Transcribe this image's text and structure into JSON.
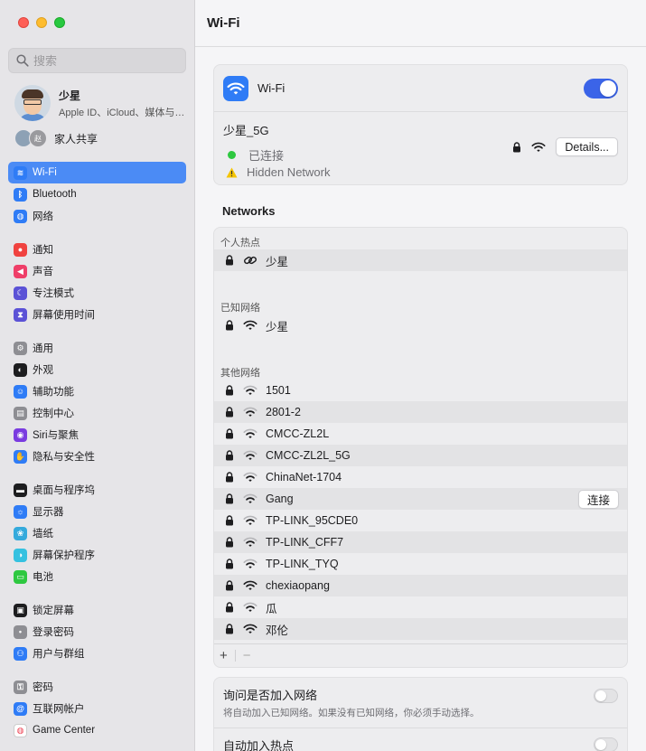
{
  "window": {
    "title": "Wi-Fi"
  },
  "search": {
    "placeholder": "搜索"
  },
  "profile": {
    "name": "少星",
    "subtitle": "Apple ID、iCloud、媒体与 App Store"
  },
  "family": {
    "label": "家人共享",
    "badge": "赵"
  },
  "sidebar": {
    "groups": [
      [
        {
          "label": "Wi-Fi",
          "icon": "wifi-icon",
          "color": "#2f7cf6",
          "active": true
        },
        {
          "label": "Bluetooth",
          "icon": "bluetooth-icon",
          "color": "#2f7cf6"
        },
        {
          "label": "网络",
          "icon": "globe-icon",
          "color": "#2f7cf6"
        }
      ],
      [
        {
          "label": "通知",
          "icon": "bell-icon",
          "color": "#f0423f"
        },
        {
          "label": "声音",
          "icon": "speaker-icon",
          "color": "#ef3e68"
        },
        {
          "label": "专注模式",
          "icon": "moon-icon",
          "color": "#5b52d6"
        },
        {
          "label": "屏幕使用时间",
          "icon": "hourglass-icon",
          "color": "#5b52d6"
        }
      ],
      [
        {
          "label": "通用",
          "icon": "gear-icon",
          "color": "#8e8e93"
        },
        {
          "label": "外观",
          "icon": "appearance-icon",
          "color": "#1d1d1f"
        },
        {
          "label": "辅助功能",
          "icon": "accessibility-icon",
          "color": "#2f7cf6"
        },
        {
          "label": "控制中心",
          "icon": "control-center-icon",
          "color": "#8e8e93"
        },
        {
          "label": "Siri与聚焦",
          "icon": "siri-icon",
          "color": "#7a3be0"
        },
        {
          "label": "隐私与安全性",
          "icon": "hand-icon",
          "color": "#2f7cf6"
        }
      ],
      [
        {
          "label": "桌面与程序坞",
          "icon": "dock-icon",
          "color": "#1d1d1f"
        },
        {
          "label": "显示器",
          "icon": "display-icon",
          "color": "#2f7cf6"
        },
        {
          "label": "墙纸",
          "icon": "wallpaper-icon",
          "color": "#35aadc"
        },
        {
          "label": "屏幕保护程序",
          "icon": "screensaver-icon",
          "color": "#35c1e0"
        },
        {
          "label": "电池",
          "icon": "battery-icon",
          "color": "#2ec840"
        }
      ],
      [
        {
          "label": "锁定屏幕",
          "icon": "lock-screen-icon",
          "color": "#1d1d1f"
        },
        {
          "label": "登录密码",
          "icon": "password-icon",
          "color": "#8e8e93"
        },
        {
          "label": "用户与群组",
          "icon": "users-icon",
          "color": "#2f7cf6"
        }
      ],
      [
        {
          "label": "密码",
          "icon": "key-icon",
          "color": "#8e8e93"
        },
        {
          "label": "互联网帐户",
          "icon": "at-icon",
          "color": "#2f7cf6"
        },
        {
          "label": "Game Center",
          "icon": "game-center-icon",
          "color": "#ffffff"
        }
      ]
    ]
  },
  "wifi": {
    "label": "Wi-Fi",
    "enabled": true,
    "current": {
      "name": "少星_5G",
      "status": "已连接",
      "warning": "Hidden Network",
      "details_label": "Details..."
    }
  },
  "networks": {
    "title": "Networks",
    "hotspot_label": "个人热点",
    "hotspots": [
      {
        "name": "少星"
      }
    ],
    "known_label": "已知网络",
    "known": [
      {
        "name": "少星"
      }
    ],
    "other_label": "其他网络",
    "other": [
      {
        "name": "1501"
      },
      {
        "name": "2801-2"
      },
      {
        "name": "CMCC-ZL2L"
      },
      {
        "name": "CMCC-ZL2L_5G"
      },
      {
        "name": "ChinaNet-1704"
      },
      {
        "name": "Gang",
        "button": "连接"
      },
      {
        "name": "TP-LINK_95CDE0"
      },
      {
        "name": "TP-LINK_CFF7"
      },
      {
        "name": "TP-LINK_TYQ"
      },
      {
        "name": "chexiaopang"
      },
      {
        "name": "瓜"
      },
      {
        "name": "邓伦"
      }
    ],
    "add_label": "+",
    "remove_label": "−"
  },
  "options": {
    "ask_join": {
      "title": "询问是否加入网络",
      "desc": "将自动加入已知网络。如果没有已知网络，你必须手动选择。"
    },
    "auto_hotspot": {
      "title": "自动加入热点"
    }
  }
}
